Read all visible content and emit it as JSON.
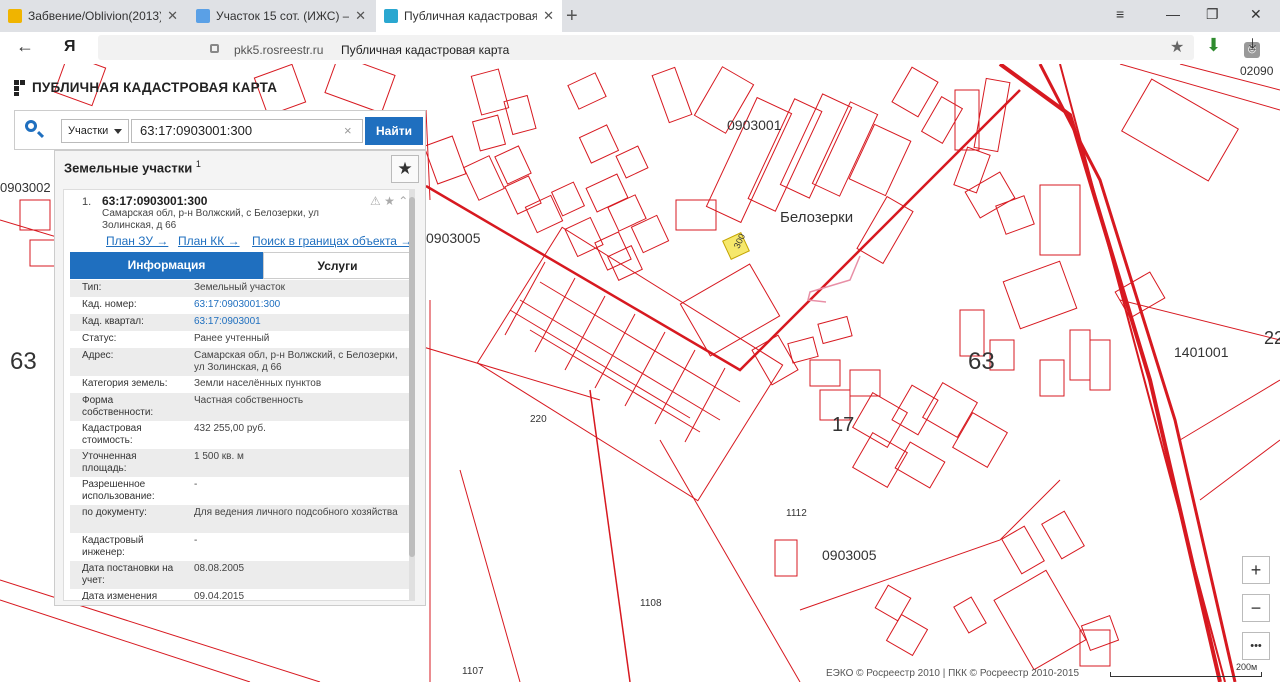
{
  "browser": {
    "tabs": [
      {
        "title": "Забвение/Oblivion(2013) —",
        "favicon_color": "#f0b400"
      },
      {
        "title": "Участок 15 сот. (ИЖС) — Р",
        "favicon_color": "#5aa0e6"
      },
      {
        "title": "Публичная кадастровая",
        "favicon_color": "#2aa7d0",
        "active": true
      }
    ],
    "new_tab": "+",
    "window_controls": {
      "menu": "≡",
      "minimize": "—",
      "maximize": "❐",
      "close": "✕"
    },
    "back": "←",
    "brand": "Я",
    "domain": "pkk5.rosreestr.ru",
    "page_title": "Публичная кадастровая карта"
  },
  "app": {
    "logo_text": "ПУБЛИЧНАЯ КАДАСТРОВАЯ КАРТА"
  },
  "search": {
    "type_label": "Участки",
    "value": "63:17:0903001:300",
    "clear": "×",
    "button": "Найти"
  },
  "results": {
    "title": "Земельные участки",
    "count": "1",
    "item": {
      "num": "1.",
      "id": "63:17:0903001:300",
      "address": "Самарская обл, р-н Волжский, с Белозерки, ул Золинская, д 66",
      "links": [
        "План ЗУ →",
        "План КК →",
        "Поиск в границах объекта →"
      ]
    },
    "tabs": {
      "info": "Информация",
      "services": "Услуги"
    },
    "rows": [
      {
        "k": "Тип:",
        "v": "Земельный участок"
      },
      {
        "k": "Кад. номер:",
        "v": "63:17:0903001:300",
        "link": true
      },
      {
        "k": "Кад. квартал:",
        "v": "63:17:0903001",
        "link": true
      },
      {
        "k": "Статус:",
        "v": "Ранее учтенный"
      },
      {
        "k": "Адрес:",
        "v": "Самарская обл, р-н Волжский, с Белозерки, ул Золинская, д 66"
      },
      {
        "k": "Категория земель:",
        "v": "Земли населённых пунктов"
      },
      {
        "k": "Форма собственности:",
        "v": "Частная собственность"
      },
      {
        "k": "Кадастровая стоимость:",
        "v": "432 255,00 руб."
      },
      {
        "k": "Уточненная площадь:",
        "v": "1 500 кв. м"
      },
      {
        "k": "Разрешенное использование:",
        "v": "-"
      },
      {
        "k": "по документу:",
        "v": "Для ведения личного подсобного хозяйства"
      },
      {
        "k": "Кадастровый инженер:",
        "v": "-"
      },
      {
        "k": "Дата постановки на учет:",
        "v": "08.08.2005"
      },
      {
        "k": "Дата изменения",
        "v": "09.04.2015"
      }
    ]
  },
  "map": {
    "labels": [
      "0903001",
      "Белозерки",
      "0903005",
      "63",
      "63",
      "1401001",
      "17",
      "0903005",
      "0903002",
      "1108",
      "1107",
      "1112",
      "220",
      "300",
      "22",
      "02090"
    ]
  },
  "controls": {
    "zoom_in": "+",
    "zoom_out": "−",
    "more": "•••"
  },
  "footer": {
    "copyright": "ЕЭКО © Росреестр 2010 | ПКК © Росреестр 2010-2015",
    "scale": "200м"
  }
}
